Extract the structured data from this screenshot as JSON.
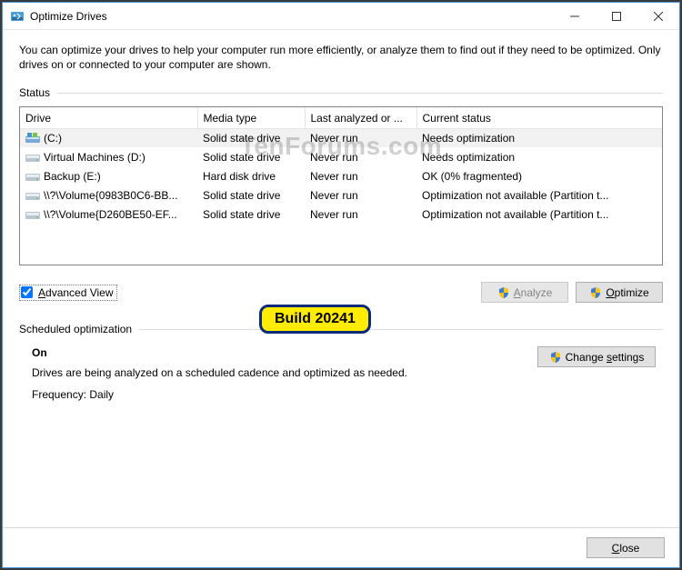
{
  "title": "Optimize Drives",
  "intro": "You can optimize your drives to help your computer run more efficiently, or analyze them to find out if they need to be optimized. Only drives on or connected to your computer are shown.",
  "status_label": "Status",
  "columns": {
    "drive": "Drive",
    "media": "Media type",
    "last": "Last analyzed or ...",
    "status": "Current status"
  },
  "rows": [
    {
      "name": "(C:)",
      "icon": "os",
      "media": "Solid state drive",
      "last": "Never run",
      "status": "Needs optimization",
      "selected": true
    },
    {
      "name": "Virtual Machines (D:)",
      "icon": "hdd",
      "media": "Solid state drive",
      "last": "Never run",
      "status": "Needs optimization"
    },
    {
      "name": "Backup (E:)",
      "icon": "hdd",
      "media": "Hard disk drive",
      "last": "Never run",
      "status": "OK (0% fragmented)"
    },
    {
      "name": "\\\\?\\Volume{0983B0C6-BB...",
      "icon": "hdd",
      "media": "Solid state drive",
      "last": "Never run",
      "status": "Optimization not available (Partition t..."
    },
    {
      "name": "\\\\?\\Volume{D260BE50-EF...",
      "icon": "hdd",
      "media": "Solid state drive",
      "last": "Never run",
      "status": "Optimization not available (Partition t..."
    }
  ],
  "advanced_view": {
    "checked": true,
    "text_pre": "A",
    "text_post": "dvanced View"
  },
  "buttons": {
    "analyze": {
      "pre": "A",
      "post": "nalyze",
      "disabled": true
    },
    "optimize": {
      "pre": "O",
      "post": "ptimize",
      "disabled": false
    },
    "change": {
      "pre": "Change ",
      "key": "s",
      "post": "ettings"
    },
    "close": {
      "pre": "C",
      "post": "lose"
    }
  },
  "sched": {
    "label": "Scheduled optimization",
    "state": "On",
    "desc": "Drives are being analyzed on a scheduled cadence and optimized as needed.",
    "freq": "Frequency: Daily"
  },
  "badge": "Build 20241",
  "watermark": "TenForums.com"
}
